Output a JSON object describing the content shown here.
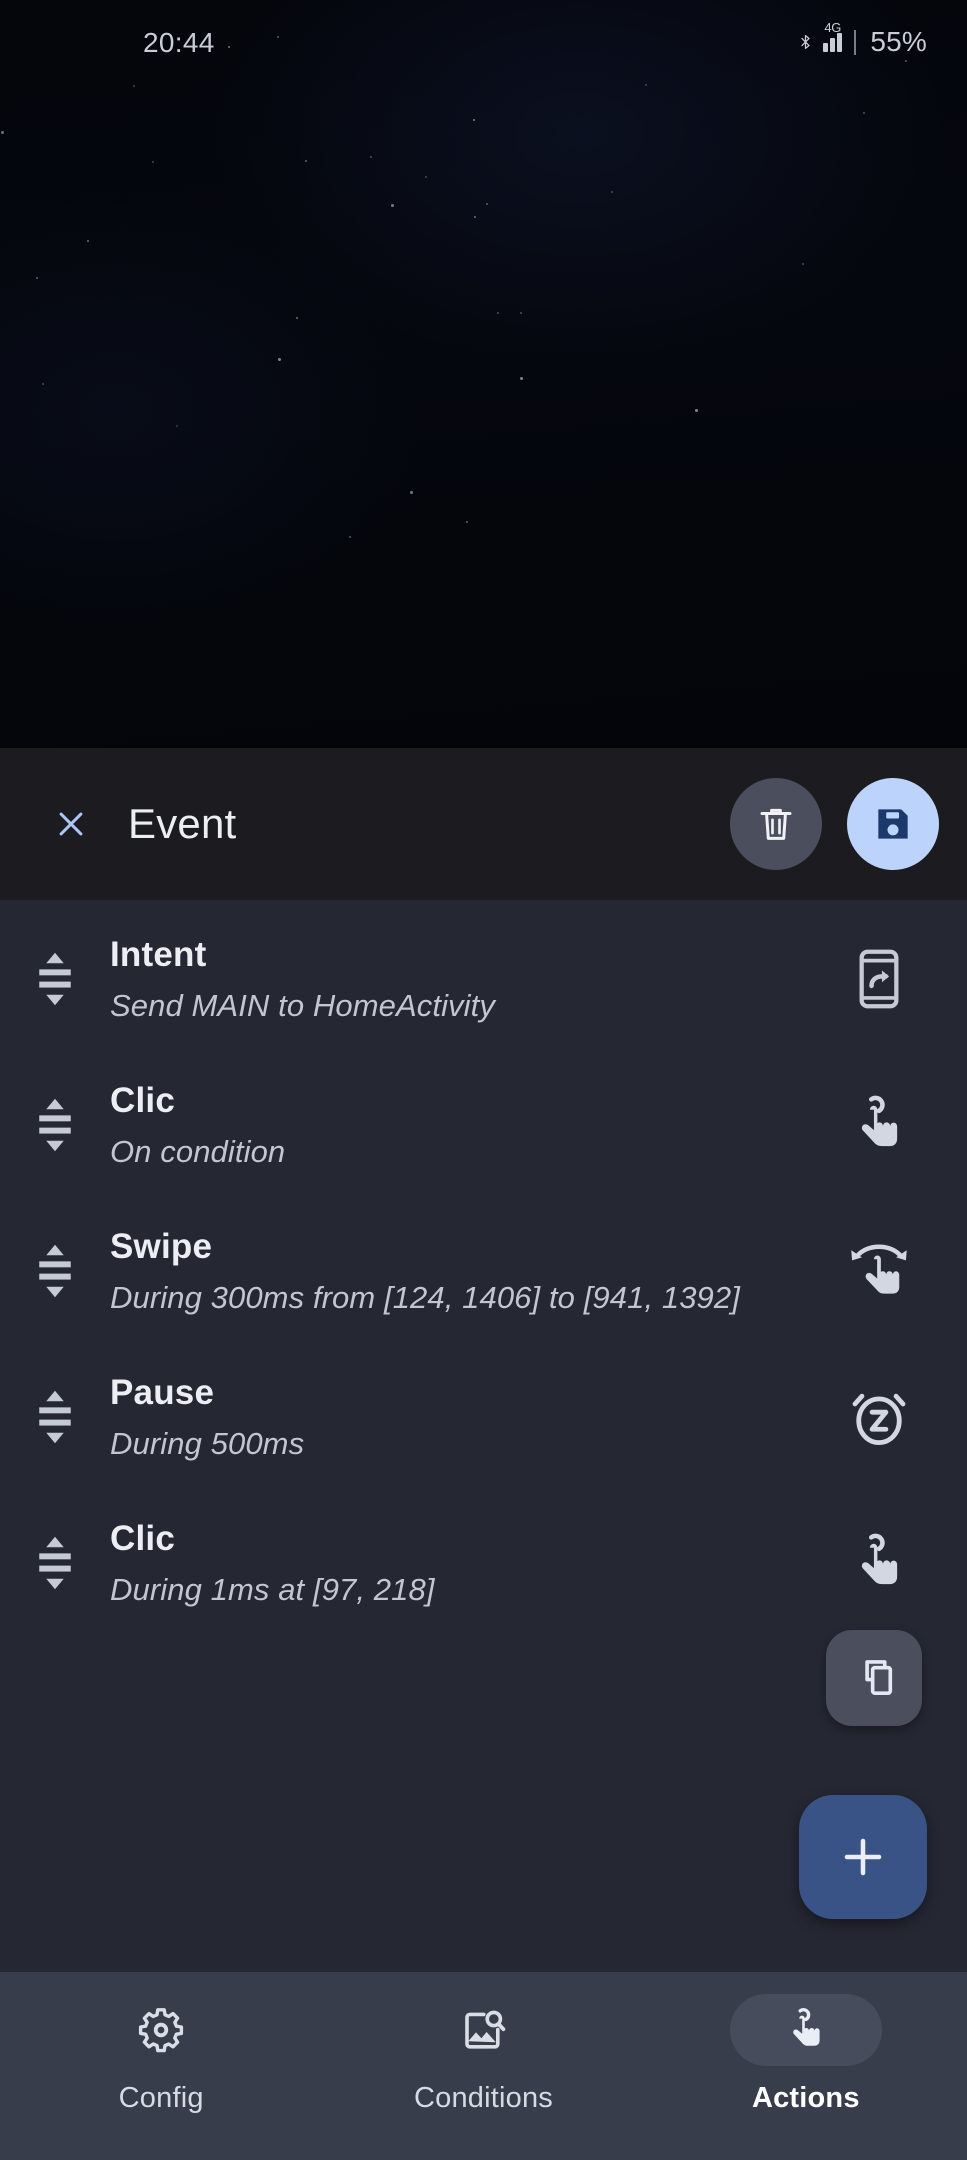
{
  "status_bar": {
    "time": "20:44",
    "bluetooth_icon": "bluetooth-icon",
    "network_label": "4G",
    "signal_icon": "signal-bars-icon",
    "battery": "55%"
  },
  "header": {
    "close_icon": "close-icon",
    "title": "Event",
    "delete_icon": "trash-icon",
    "save_icon": "save-floppy-icon"
  },
  "actions": [
    {
      "title": "Intent",
      "subtitle": "Send MAIN to HomeActivity",
      "icon": "phone-share-icon",
      "handle_icon": "drag-handle-icon"
    },
    {
      "title": "Clic",
      "subtitle": "On condition",
      "icon": "tap-hand-icon",
      "handle_icon": "drag-handle-icon"
    },
    {
      "title": "Swipe",
      "subtitle": "During 300ms from [124, 1406] to [941, 1392]",
      "icon": "swipe-hand-icon",
      "handle_icon": "drag-handle-icon"
    },
    {
      "title": "Pause",
      "subtitle": "During 500ms",
      "icon": "alarm-snooze-icon",
      "handle_icon": "drag-handle-icon"
    },
    {
      "title": "Clic",
      "subtitle": "During 1ms at [97, 218]",
      "icon": "tap-hand-icon",
      "handle_icon": "drag-handle-icon"
    }
  ],
  "floating_buttons": {
    "copy_icon": "copy-icon",
    "add_icon": "plus-icon"
  },
  "bottom_nav": {
    "items": [
      {
        "label": "Config",
        "icon": "gear-icon",
        "selected": false
      },
      {
        "label": "Conditions",
        "icon": "image-search-icon",
        "selected": false
      },
      {
        "label": "Actions",
        "icon": "tap-hand-icon",
        "selected": true
      }
    ]
  },
  "colors": {
    "wallpaper": "#05070d",
    "header_bg": "#1c1c20",
    "list_bg": "#252733",
    "nav_bg": "#383d4b",
    "accent_light_blue": "#bcd4fb",
    "accent_blue": "#3a5386",
    "neutral_button": "#4b4f5d",
    "text_primary": "#eceef3",
    "text_secondary": "#c2c6d0"
  }
}
